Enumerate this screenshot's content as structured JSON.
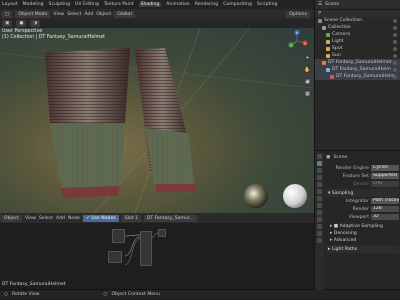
{
  "menu": {
    "items": [
      "Layout",
      "Modeling",
      "Sculpting",
      "UV Editing",
      "Texture Paint",
      "Shading",
      "Animation",
      "Rendering",
      "Compositing",
      "Scripting"
    ],
    "active": "Shading"
  },
  "topbar": {
    "scene_label": "Scene",
    "view_layer": "ViewLayer"
  },
  "viewport_header": {
    "mode": "Object Mode",
    "menus": [
      "View",
      "Select",
      "Add",
      "Object"
    ],
    "pivot": "Global",
    "shading": "Options"
  },
  "viewport": {
    "title": "User Perspective",
    "collection": "(1) Collection | DT Fantasy_SamuraiHelmet",
    "gizmo": {
      "x": "X",
      "y": "Y",
      "z": "Z"
    }
  },
  "node_header": {
    "editor": "Object",
    "menus": [
      "View",
      "Select",
      "Add",
      "Node"
    ],
    "use_nodes": "Use Nodes",
    "slot": "Slot 1",
    "material": "DT Fantasy_Samur..."
  },
  "node_editor": {
    "material_label": "DT Fantasy_SamuraiHelmet"
  },
  "outliner": {
    "title": "Scene Collection",
    "items": [
      {
        "label": "Scene Collection",
        "depth": 0,
        "color": "#8a8a8a"
      },
      {
        "label": "Collection",
        "depth": 1,
        "color": "#9a9a9a"
      },
      {
        "label": "Camera",
        "depth": 2,
        "color": "#6aa06a"
      },
      {
        "label": "Light",
        "depth": 2,
        "color": "#d0b050"
      },
      {
        "label": "Spot",
        "depth": 2,
        "color": "#d0b050"
      },
      {
        "label": "Sun",
        "depth": 2,
        "color": "#d0b050"
      },
      {
        "label": "DT Fantasy_SamuraiHelmet",
        "depth": 1,
        "color": "#e08040"
      },
      {
        "label": "DT Fantasy_SamuraiHelm",
        "depth": 2,
        "color": "#7fb0e0"
      },
      {
        "label": "DT Fantasy_SamuraiHelm",
        "depth": 3,
        "color": "#c06060"
      }
    ]
  },
  "properties": {
    "scene": "Scene",
    "render_engine_label": "Render Engine",
    "render_engine": "Cycles",
    "feature_set_label": "Feature Set",
    "feature_set": "Supported",
    "device_label": "Device",
    "device": "CPU",
    "sampling_label": "Sampling",
    "integrator_label": "Integrator",
    "integrator": "Path Tracing",
    "render_label": "Render",
    "render_value": "128",
    "viewport_label": "Viewport",
    "viewport_value": "32",
    "sections": [
      "Adaptive Sampling",
      "Denoising",
      "Advanced"
    ],
    "light_paths": "Light Paths"
  },
  "status": {
    "left": "Rotate View",
    "middle": "Object Context Menu"
  },
  "colors": {
    "accent": "#5a7aa8",
    "selected": "#3a3f4a"
  }
}
